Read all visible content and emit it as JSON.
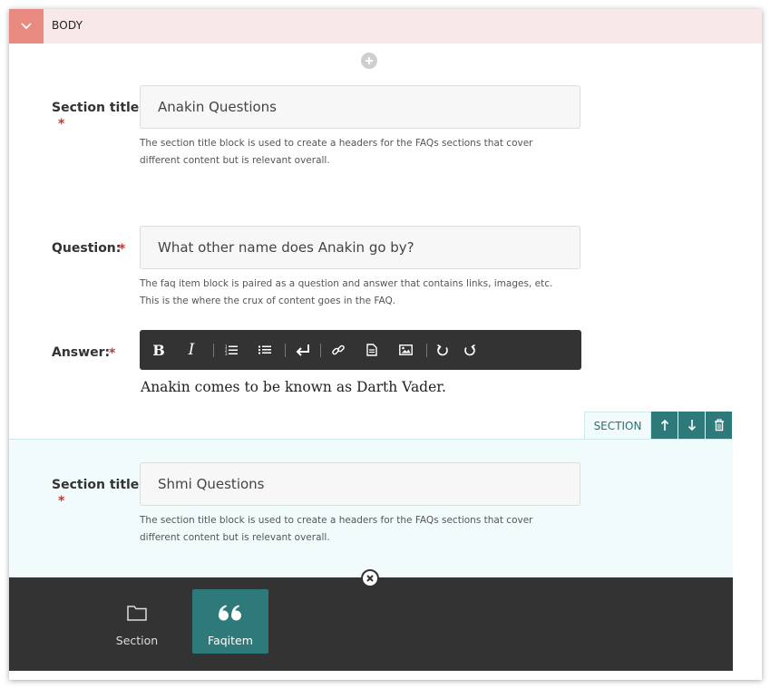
{
  "header": {
    "title": "BODY"
  },
  "section1": {
    "title_label": "Section title:",
    "required_mark": "*",
    "title_value": "Anakin Questions",
    "help_text": "The section title block is used to create a headers for the FAQs sections that cover different content but is relevant overall."
  },
  "faqitem": {
    "question_label": "Question:",
    "required_mark": "*",
    "question_value": "What other name does Anakin go by?",
    "question_help": "The faq item block is paired as a question and answer that contains links, images, etc. This is the where the crux of content goes in the FAQ.",
    "answer_label": "Answer:",
    "answer_text": "Anakin comes to be known as Darth Vader."
  },
  "toolbar": {
    "bold": "B",
    "italic": "I",
    "icons": [
      "bold-icon",
      "italic-icon",
      "ordered-list-icon",
      "bullet-list-icon",
      "line-break-icon",
      "link-icon",
      "document-icon",
      "image-icon",
      "undo-icon",
      "redo-icon"
    ]
  },
  "section_controls": {
    "tag_label": "SECTION"
  },
  "section2": {
    "title_label": "Section title:",
    "required_mark": "*",
    "title_value": "Shmi Questions",
    "help_text": "The section title block is used to create a headers for the FAQs sections that cover different content but is relevant overall."
  },
  "block_picker": {
    "items": [
      {
        "label": "Section",
        "icon": "folder-icon"
      },
      {
        "label": "Faqitem",
        "icon": "quote-icon"
      }
    ]
  },
  "colors": {
    "header_bg": "#f9e8e8",
    "toggle_accent": "#e88a80",
    "teal": "#2e7a7a",
    "toolbar_bg": "#333333",
    "required": "#c0392b",
    "section_bg": "#f2fbfb"
  }
}
